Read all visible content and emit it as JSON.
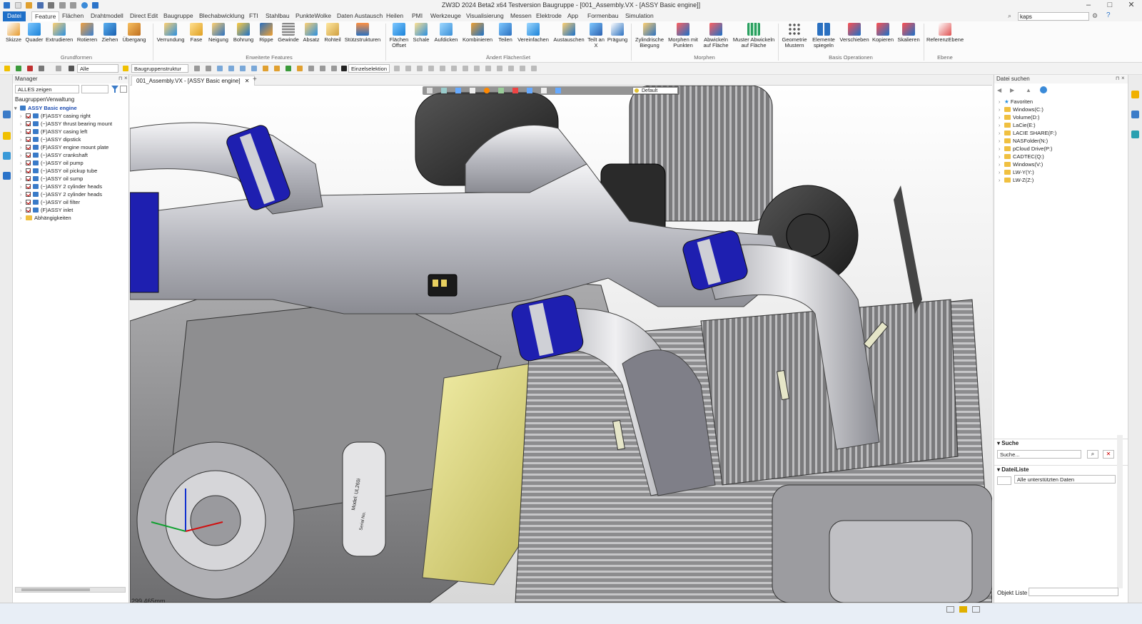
{
  "window": {
    "title": "ZW3D 2024 Beta2 x64 Testversion          Baugruppe - [001_Assembly.VX - [ASSY Basic engine]]"
  },
  "menu": {
    "items": [
      "Datei",
      "Feature",
      "Flächen",
      "Drahtmodell",
      "Direct Edit",
      "Baugruppe",
      "Blechabwicklung",
      "FTI",
      "Stahlbau",
      "PunkteWolke",
      "Daten Austausch",
      "Heilen",
      "PMI",
      "Werkzeuge",
      "Visualisierung",
      "Messen",
      "Elektrode",
      "App",
      "Formenbau",
      "Simulation"
    ],
    "active": "Feature",
    "search_value": "kaps"
  },
  "ribbon": {
    "groups": [
      {
        "label": "Grundformen",
        "buttons": [
          "Skizze",
          "Quader",
          "Extrudieren",
          "Rotieren",
          "Ziehen",
          "Übergang"
        ]
      },
      {
        "label": "Erweiterte Features",
        "buttons": [
          "Verrundung",
          "Fase",
          "Neigung",
          "Bohrung",
          "Rippe",
          "Gewinde",
          "Absatz",
          "Rohteil",
          "Stützstrukturen"
        ]
      },
      {
        "label": "Ändert FlächenSet",
        "buttons": [
          "Flächen Offset",
          "Schale",
          "Aufdicken",
          "Kombinieren",
          "Teilen",
          "Vereinfachen",
          "Austauschen",
          "Teilt an X",
          "Prägung"
        ]
      },
      {
        "label": "Morphen",
        "buttons": [
          "Zylindrische Biegung",
          "Morphen mit Punkten",
          "Abwickeln auf Fläche",
          "Muster Abwickeln auf Fläche"
        ]
      },
      {
        "label": "Basis Operationen",
        "buttons": [
          "Geometrie Mustern",
          "Elemente spiegeln",
          "Verschieben",
          "Kopieren",
          "Skalieren"
        ]
      },
      {
        "label": "Ebene",
        "buttons": [
          "ReferenzEbene"
        ]
      }
    ]
  },
  "toolbar2": {
    "filter_value": "Alle",
    "structure_value": "Baugruppenstruktur",
    "selection_value": "Einzelselektion",
    "view_style": "Default"
  },
  "manager": {
    "title": "Manager",
    "filter_value": "ALLES zeigen",
    "section": "BaugruppenVerwaltung",
    "root": "ASSY Basic engine",
    "items": [
      "(F)ASSY casing right",
      "(−)ASSY thrust bearing mount",
      "(F)ASSY casing left",
      "(−)ASSY dipstick",
      "(F)ASSY engine mount plate",
      "(−)ASSY crankshaft",
      "(−)ASSY oil pump",
      "(−)ASSY oil pickup tube",
      "(−)ASSY oil sump",
      "(−)ASSY 2 cylinder heads",
      "(−)ASSY 2 cylinder heads",
      "(−)ASSY oil filter",
      "(F)ASSY inlet"
    ],
    "deps": "Abhängigkeiten"
  },
  "document": {
    "tab": "001_Assembly.VX - [ASSY Basic engine]"
  },
  "viewport": {
    "measurement": "299.465mm",
    "plate_model": "Model: UL260i",
    "plate_serial": "Serial No."
  },
  "right_panel": {
    "title": "Datei suchen",
    "nodes": [
      "Favoriten",
      "Windows(C:)",
      "Volume(D:)",
      "LaCie(E:)",
      "LACIE SHARE(F:)",
      "NASFolder(N:)",
      "pCloud Drive(P:)",
      "CADTEC(Q:)",
      "Windows(V:)",
      "LW-Y(Y:)",
      "LW-Z(Z:)"
    ],
    "search_section": "Suche",
    "search_placeholder": "Suche...",
    "filelist_section": "DateiListe",
    "filetype_value": "Alle unterstützten Daten",
    "objekt_label": "Objekt Liste"
  }
}
